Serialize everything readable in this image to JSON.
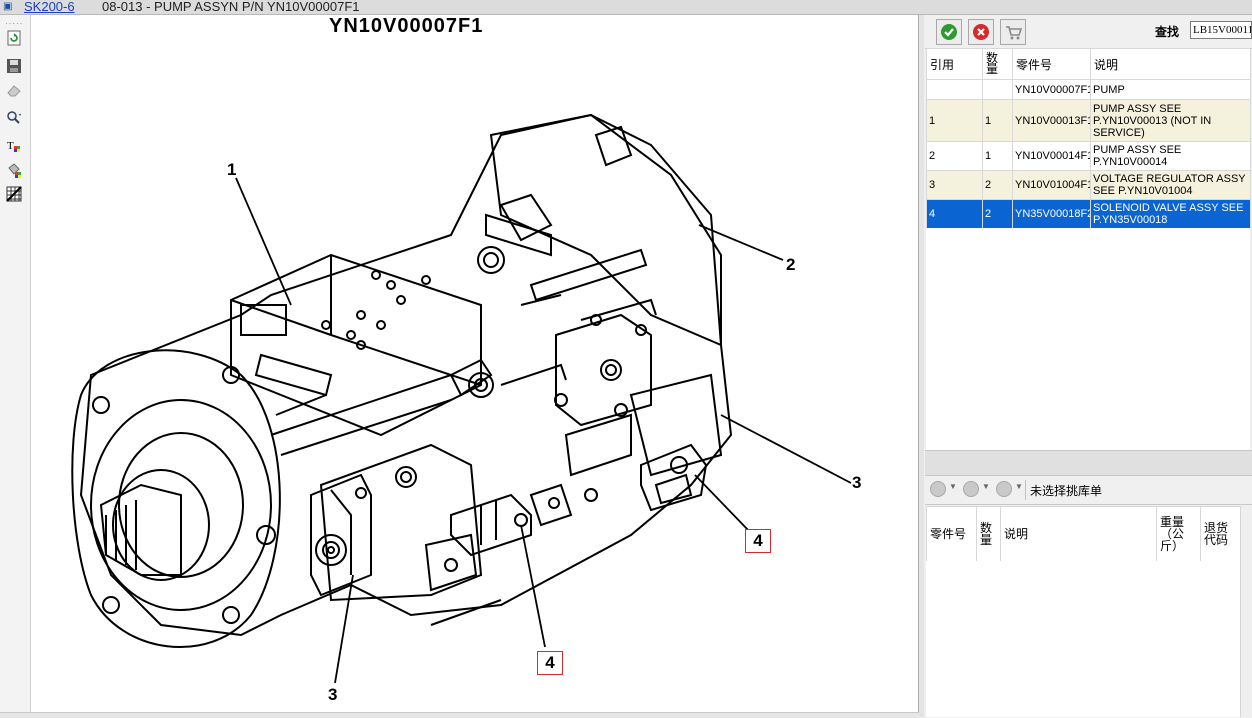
{
  "window": {
    "model_link": "SK200-6",
    "title": "08-013 - PUMP ASSYN P/N YN10V00007F1"
  },
  "drawing": {
    "header": "YN10V00007F1",
    "callouts": [
      "1",
      "2",
      "3",
      "3",
      "4",
      "4"
    ]
  },
  "left_toolbar": {
    "icons": [
      "refresh-icon",
      "save-icon",
      "eraser-icon",
      "zoom-icon",
      "text-color-icon",
      "color-fill-icon",
      "pattern-icon"
    ]
  },
  "parts_toolbar": {
    "search_label": "查找",
    "search_value": "LB15V00011"
  },
  "parts_table": {
    "headers": [
      "引用",
      "数量",
      "零件号",
      "说明"
    ],
    "rows": [
      {
        "ref": "",
        "qty": "",
        "part": "YN10V00007F1",
        "desc": "PUMP"
      },
      {
        "ref": "1",
        "qty": "1",
        "part": "YN10V00013F1",
        "desc": "PUMP ASSY SEE P.YN10V00013 (NOT IN SERVICE)"
      },
      {
        "ref": "2",
        "qty": "1",
        "part": "YN10V00014F1",
        "desc": "PUMP ASSY SEE P.YN10V00014"
      },
      {
        "ref": "3",
        "qty": "2",
        "part": "YN10V01004F1",
        "desc": "VOLTAGE REGULATOR ASSY SEE P.YN10V01004"
      },
      {
        "ref": "4",
        "qty": "2",
        "part": "YN35V00018F2",
        "desc": "SOLENOID VALVE ASSY SEE P.YN35V00018"
      }
    ]
  },
  "pick_toolbar": {
    "status": "未选择挑库单"
  },
  "pick_table": {
    "headers": [
      "零件号",
      "数量",
      "说明",
      "重量（公斤）",
      "退货代码"
    ]
  }
}
